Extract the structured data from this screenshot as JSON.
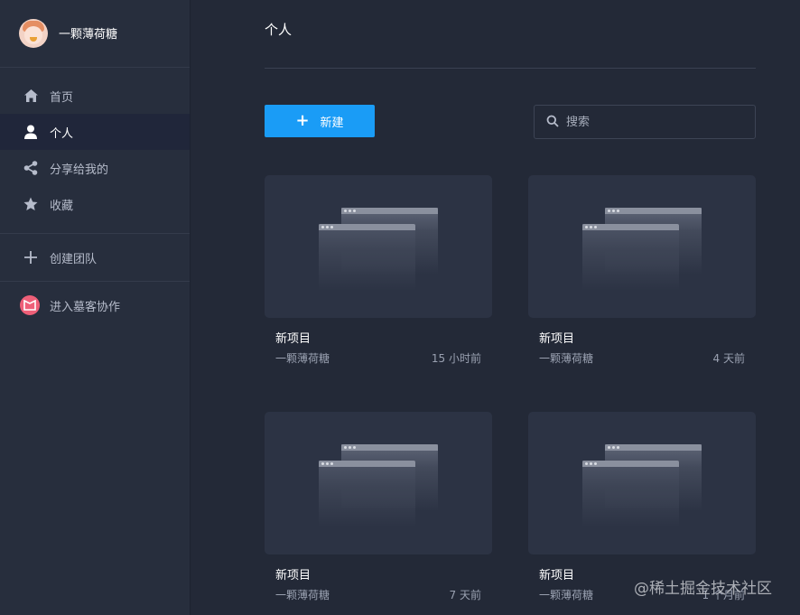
{
  "sidebar": {
    "username": "一颗薄荷糖",
    "nav": [
      {
        "label": "首页",
        "icon": "home-icon"
      },
      {
        "label": "个人",
        "icon": "user-icon"
      },
      {
        "label": "分享给我的",
        "icon": "share-icon"
      },
      {
        "label": "收藏",
        "icon": "star-icon"
      }
    ],
    "create_team": "创建团队",
    "mock_collab": "进入墓客协作"
  },
  "main": {
    "title": "个人",
    "new_button": "新建",
    "search_placeholder": "搜索",
    "projects": [
      {
        "name": "新项目",
        "owner": "一颗薄荷糖",
        "time": "15 小时前"
      },
      {
        "name": "新项目",
        "owner": "一颗薄荷糖",
        "time": "4 天前"
      },
      {
        "name": "新项目",
        "owner": "一颗薄荷糖",
        "time": "7 天前"
      },
      {
        "name": "新项目",
        "owner": "一颗薄荷糖",
        "time": "1 个月前"
      }
    ]
  },
  "watermark": "@稀土掘金技术社区",
  "colors": {
    "accent": "#1a9cf6",
    "sidebar_bg": "#272e3d",
    "main_bg": "#232937"
  }
}
